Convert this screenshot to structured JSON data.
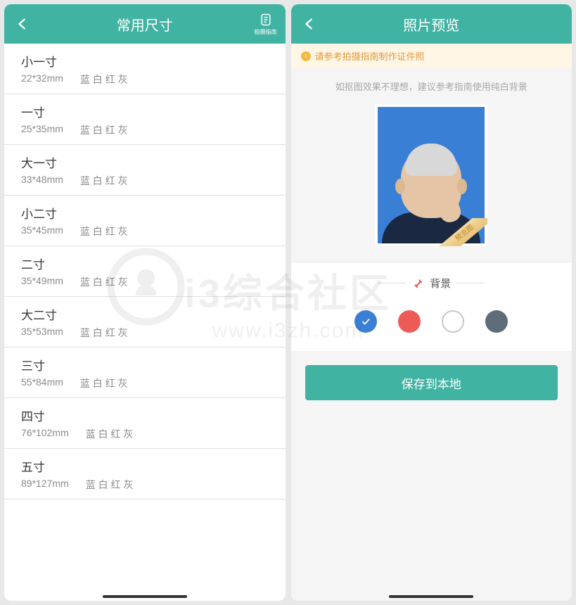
{
  "left": {
    "title": "常用尺寸",
    "guide_label": "拍摄指南",
    "sizes": [
      {
        "name": "小一寸",
        "dim": "22*32mm",
        "colors": "蓝 白 红 灰"
      },
      {
        "name": "一寸",
        "dim": "25*35mm",
        "colors": "蓝 白 红 灰"
      },
      {
        "name": "大一寸",
        "dim": "33*48mm",
        "colors": "蓝 白 红 灰"
      },
      {
        "name": "小二寸",
        "dim": "35*45mm",
        "colors": "蓝 白 红 灰"
      },
      {
        "name": "二寸",
        "dim": "35*49mm",
        "colors": "蓝 白 红 灰"
      },
      {
        "name": "大二寸",
        "dim": "35*53mm",
        "colors": "蓝 白 红 灰"
      },
      {
        "name": "三寸",
        "dim": "55*84mm",
        "colors": "蓝 白 红 灰"
      },
      {
        "name": "四寸",
        "dim": "76*102mm",
        "colors": "蓝 白 红 灰"
      },
      {
        "name": "五寸",
        "dim": "89*127mm",
        "colors": "蓝 白 红 灰"
      }
    ]
  },
  "right": {
    "title": "照片预览",
    "tip": "请参考拍摄指南制作证件照",
    "hint": "如抠图效果不理想，建议参考指南使用纯白背景",
    "ribbon": "预览图",
    "bg_label": "背景",
    "swatches": [
      {
        "name": "blue",
        "hex": "#3a7fd6",
        "selected": true
      },
      {
        "name": "red",
        "hex": "#ec5b56",
        "selected": false
      },
      {
        "name": "white",
        "hex": "#ffffff",
        "selected": false
      },
      {
        "name": "grey",
        "hex": "#5e6b78",
        "selected": false
      }
    ],
    "save_label": "保存到本地"
  },
  "watermark": {
    "title": "i3综合社区",
    "url": "www.i3zh.com"
  }
}
